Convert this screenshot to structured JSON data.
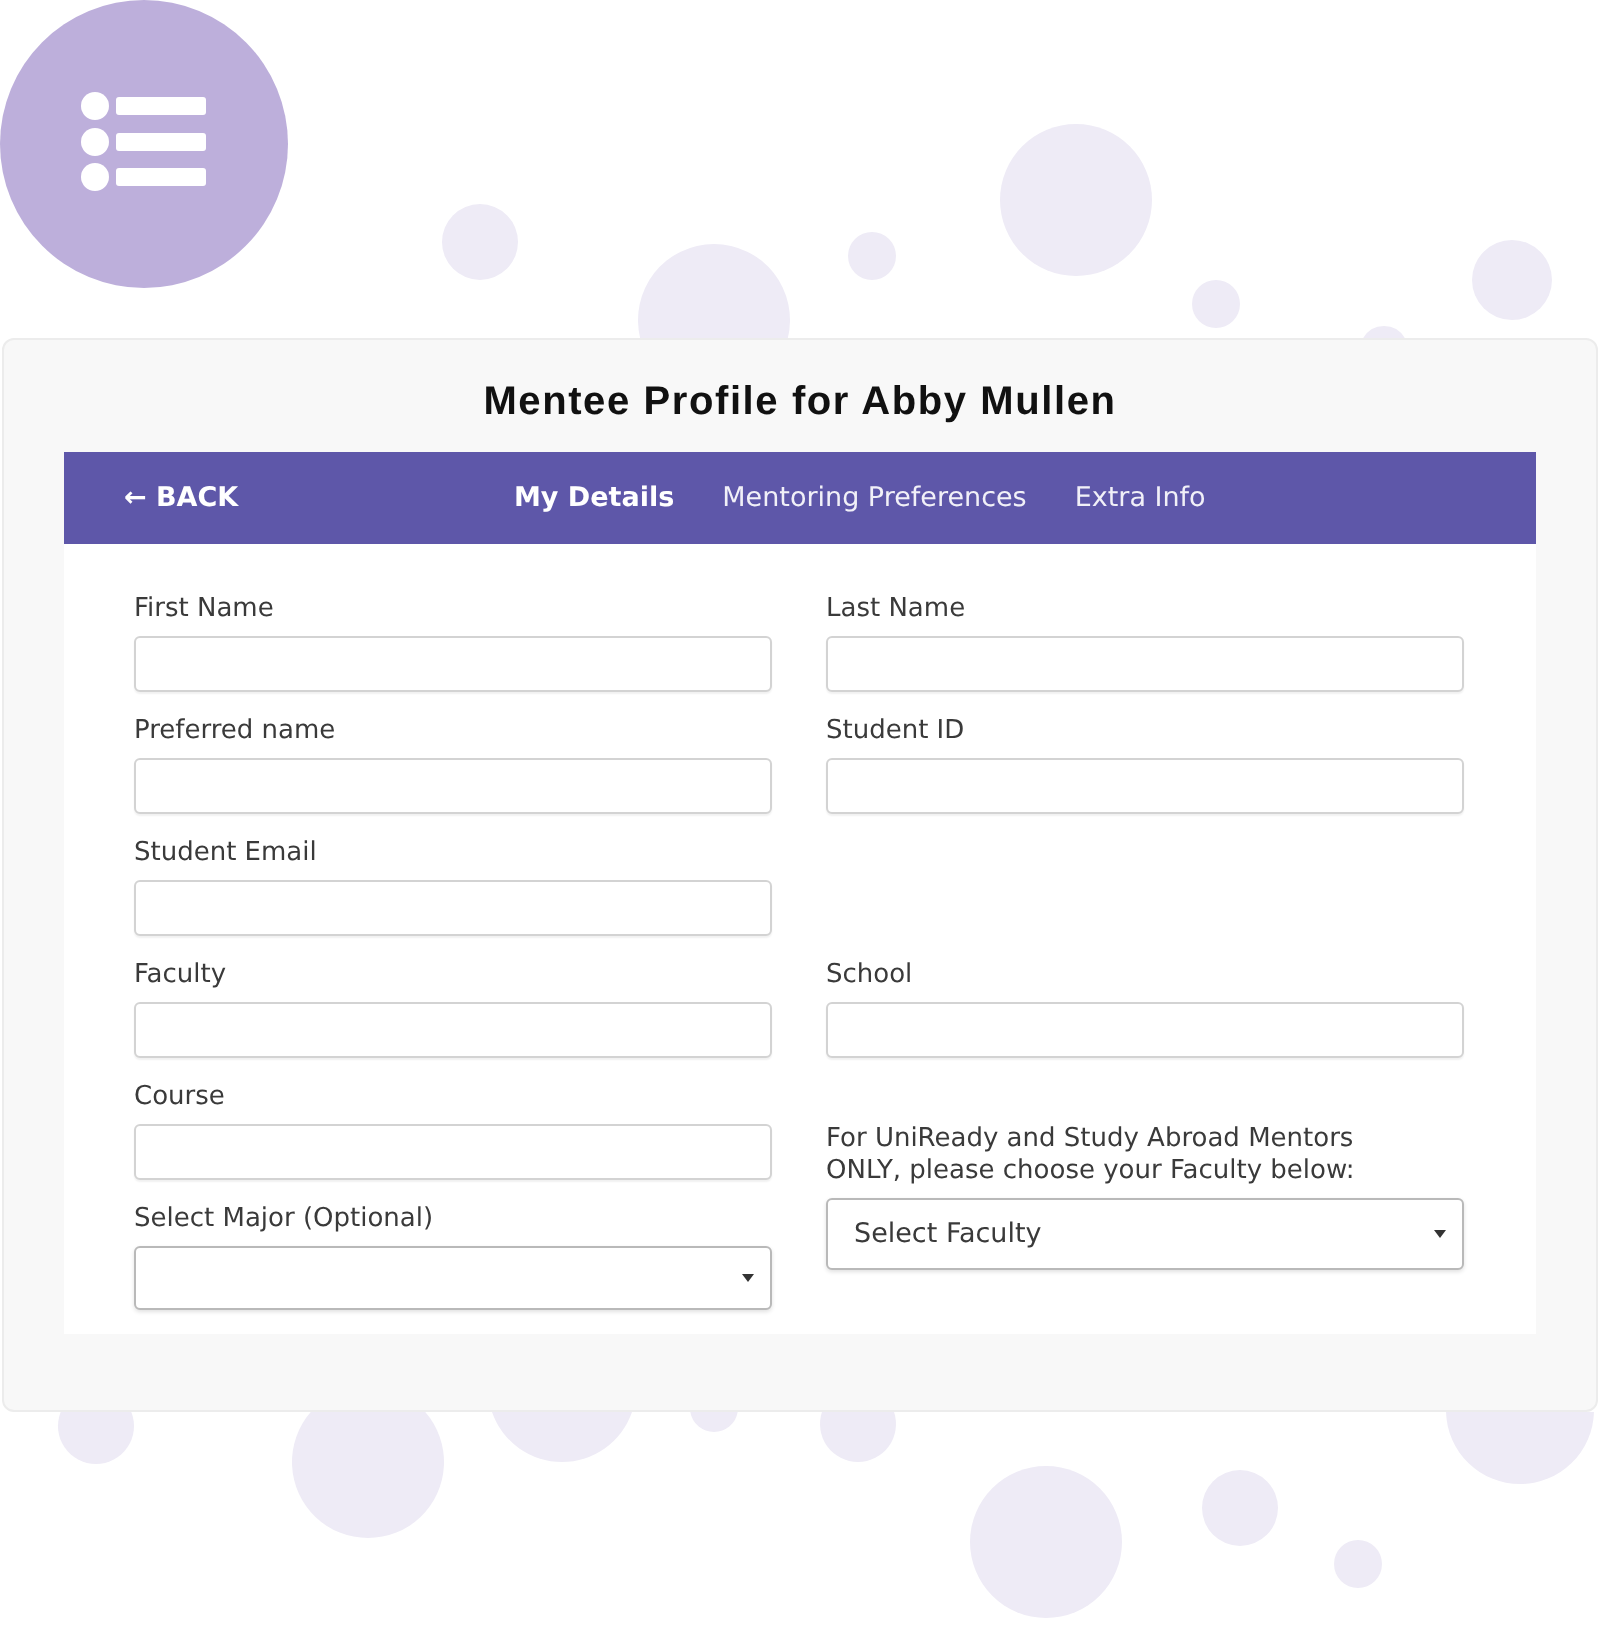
{
  "title": "Mentee Profile for Abby Mullen",
  "nav": {
    "back": "← BACK",
    "tabs": [
      {
        "label": "My Details",
        "selected": true
      },
      {
        "label": "Mentoring Preferences",
        "selected": false
      },
      {
        "label": "Extra Info",
        "selected": false
      }
    ]
  },
  "form": {
    "rows": [
      {
        "left": [
          {
            "kind": "text",
            "label": "First Name"
          }
        ],
        "right": [
          {
            "kind": "text",
            "label": "Last Name"
          }
        ]
      },
      {
        "left": [
          {
            "kind": "text",
            "label": "Preferred name"
          }
        ],
        "right": [
          {
            "kind": "text",
            "label": "Student ID"
          }
        ]
      },
      {
        "left": [
          {
            "kind": "text",
            "label": "Student Email"
          }
        ]
      },
      {
        "left": [
          {
            "kind": "text",
            "label": "Faculty"
          }
        ],
        "right": [
          {
            "kind": "text",
            "label": "School"
          }
        ]
      },
      {
        "left": [
          {
            "kind": "text",
            "label": "Course"
          },
          {
            "kind": "select",
            "label": "Select Major (Optional)"
          }
        ],
        "right": [
          {
            "kind": "select",
            "label": "For UniReady and Study Abroad Mentors ONLY, please choose your Faculty below:",
            "value": "Select Faculty"
          }
        ]
      }
    ]
  }
}
